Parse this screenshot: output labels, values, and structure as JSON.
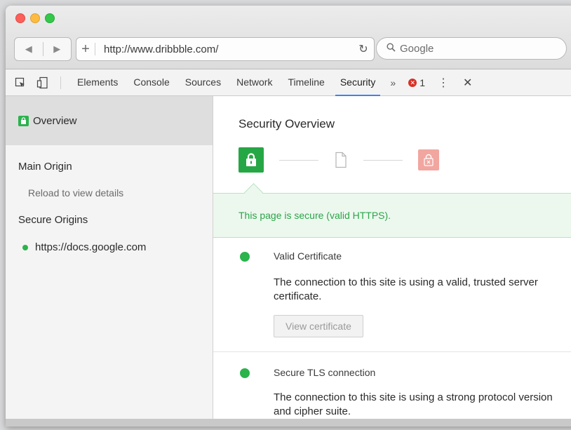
{
  "browser": {
    "url": "http://www.dribbble.com/",
    "search_placeholder": "Google",
    "new_tab": "+",
    "back": "◀",
    "forward": "▶",
    "reload": "↻"
  },
  "devtools": {
    "tabs": [
      {
        "label": "Elements"
      },
      {
        "label": "Console"
      },
      {
        "label": "Sources"
      },
      {
        "label": "Network"
      },
      {
        "label": "Timeline"
      },
      {
        "label": "Security",
        "active": true
      }
    ],
    "more": "»",
    "error_count": "1",
    "kebab": "⋮",
    "close": "✕"
  },
  "sidebar": {
    "overview": "Overview",
    "main_origin": "Main Origin",
    "reload_hint": "Reload to view details",
    "secure_origins": "Secure Origins",
    "origins": [
      {
        "label": "https://docs.google.com"
      }
    ]
  },
  "main": {
    "title": "Security Overview",
    "banner": "This page is secure (valid HTTPS).",
    "items": [
      {
        "heading": "Valid Certificate",
        "description": "The connection to this site is using a valid, trusted server certificate.",
        "button": "View certificate"
      },
      {
        "heading": "Secure TLS connection",
        "description": "The connection to this site is using a strong protocol version and cipher suite."
      }
    ]
  },
  "colors": {
    "secure_green": "#26a745",
    "banner_bg": "#ecf8ee",
    "insecure_red": "#f2a6a0",
    "active_tab": "#3a82f7"
  }
}
